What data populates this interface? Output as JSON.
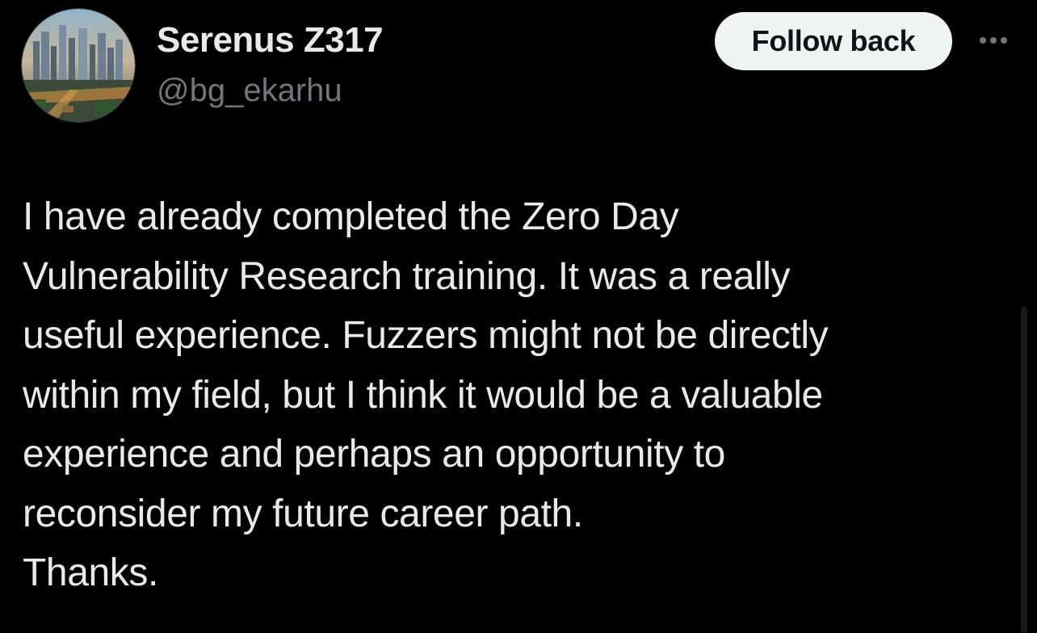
{
  "author": {
    "display_name": "Serenus Z317",
    "handle": "@bg_ekarhu",
    "avatar_icon": "city-skyline-avatar-icon"
  },
  "actions": {
    "follow_label": "Follow back",
    "more_icon": "more-horizontal-icon"
  },
  "post": {
    "lines": [
      "I have already completed the Zero Day",
      "Vulnerability Research training. It was a really",
      "useful experience. Fuzzers might not be directly",
      "within my field, but I think it would be a valuable",
      "experience and perhaps an opportunity to",
      "reconsider my future career path.",
      "Thanks."
    ]
  },
  "colors": {
    "background": "#000000",
    "primary_text": "#e7e9ea",
    "secondary_text": "#71767b",
    "button_bg": "#eff3f4",
    "button_text": "#0f1419"
  }
}
